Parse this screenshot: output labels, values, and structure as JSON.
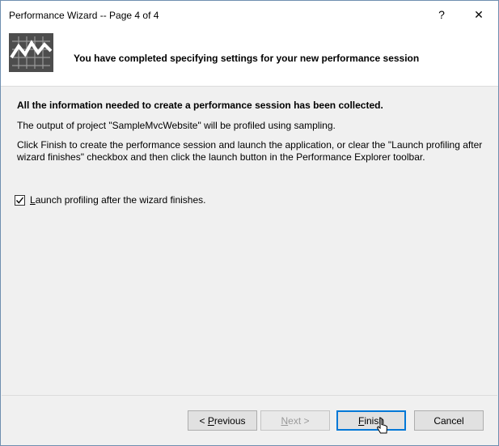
{
  "window": {
    "title": "Performance Wizard -- Page 4 of 4",
    "help_label": "?",
    "close_label": "✕"
  },
  "header": {
    "heading": "You have completed specifying settings for your new performance session",
    "logo_icon": "performance-chart-icon"
  },
  "content": {
    "summary": "All the information needed to create a performance session has been collected.",
    "project_line": "The output of project  \"SampleMvcWebsite\" will be profiled using sampling.",
    "instructions": "Click Finish to create the performance session and launch the application, or clear the \"Launch profiling after wizard finishes\" checkbox and then click the launch button in the Performance Explorer toolbar."
  },
  "checkbox": {
    "checked": true,
    "label_accesskey": "L",
    "label_rest": "aunch profiling after the wizard finishes."
  },
  "buttons": {
    "previous_prefix": "< ",
    "previous_accesskey": "P",
    "previous_rest": "revious",
    "next_accesskey": "N",
    "next_rest": "ext >",
    "finish_accesskey": "F",
    "finish_rest": "inish",
    "cancel_label": "Cancel"
  },
  "colors": {
    "dialog_bg": "#f0f0f0",
    "header_bg": "#ffffff",
    "default_button_border": "#0078d7"
  }
}
